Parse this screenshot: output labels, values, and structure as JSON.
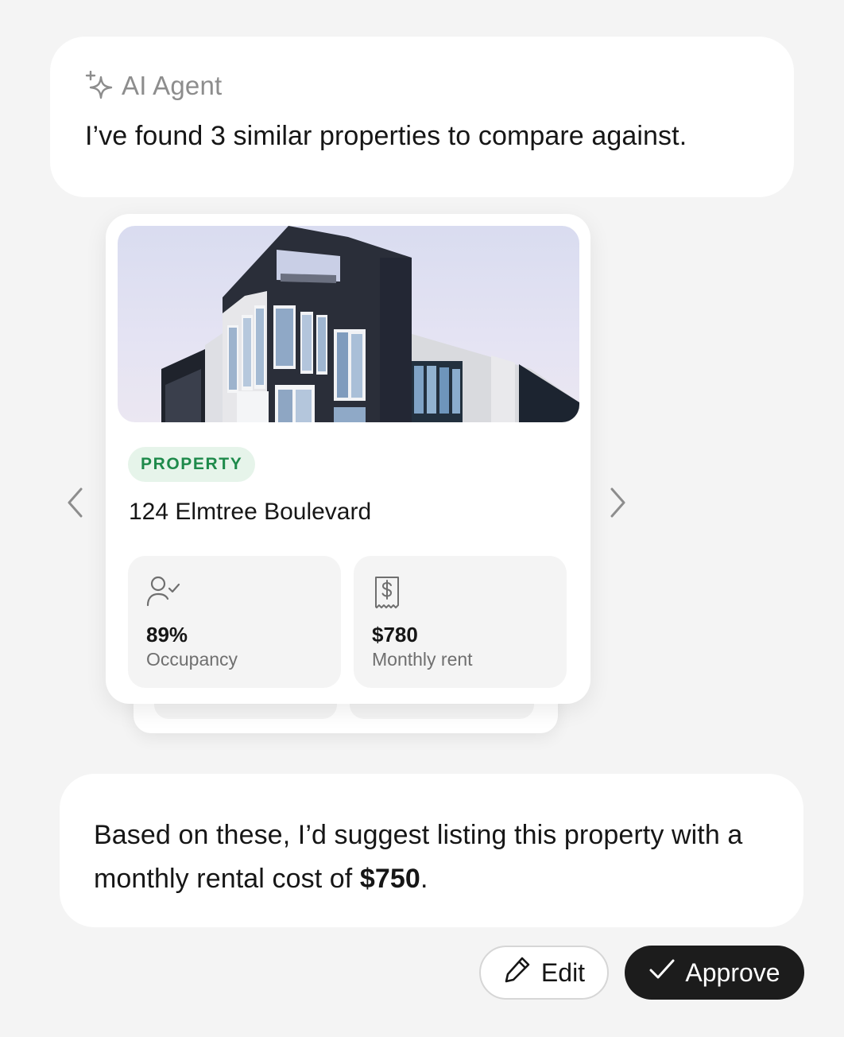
{
  "agent": {
    "name": "AI Agent",
    "icon": "sparkle-icon",
    "message": "I’ve found 3 similar properties to compare against."
  },
  "carousel": {
    "prev_icon": "chevron-left-icon",
    "next_icon": "chevron-right-icon",
    "card": {
      "image": "modern-apartment-building-photo",
      "badge": "PROPERTY",
      "address": "124 Elmtree Boulevard",
      "stats": [
        {
          "icon": "person-check-icon",
          "value": "89%",
          "label": "Occupancy"
        },
        {
          "icon": "receipt-dollar-icon",
          "value": "$780",
          "label": "Monthly rent"
        }
      ]
    }
  },
  "suggestion": {
    "text_before": "Based on these, I’d suggest listing this property with a monthly rental cost of ",
    "amount": "$750",
    "text_after": "."
  },
  "actions": {
    "edit": {
      "label": "Edit",
      "icon": "pencil-icon"
    },
    "approve": {
      "label": "Approve",
      "icon": "checkmark-icon"
    }
  },
  "colors": {
    "background": "#f4f4f4",
    "badge_bg": "#e6f4ea",
    "badge_text": "#1e8a4b",
    "approve_bg": "#1c1c1c"
  }
}
